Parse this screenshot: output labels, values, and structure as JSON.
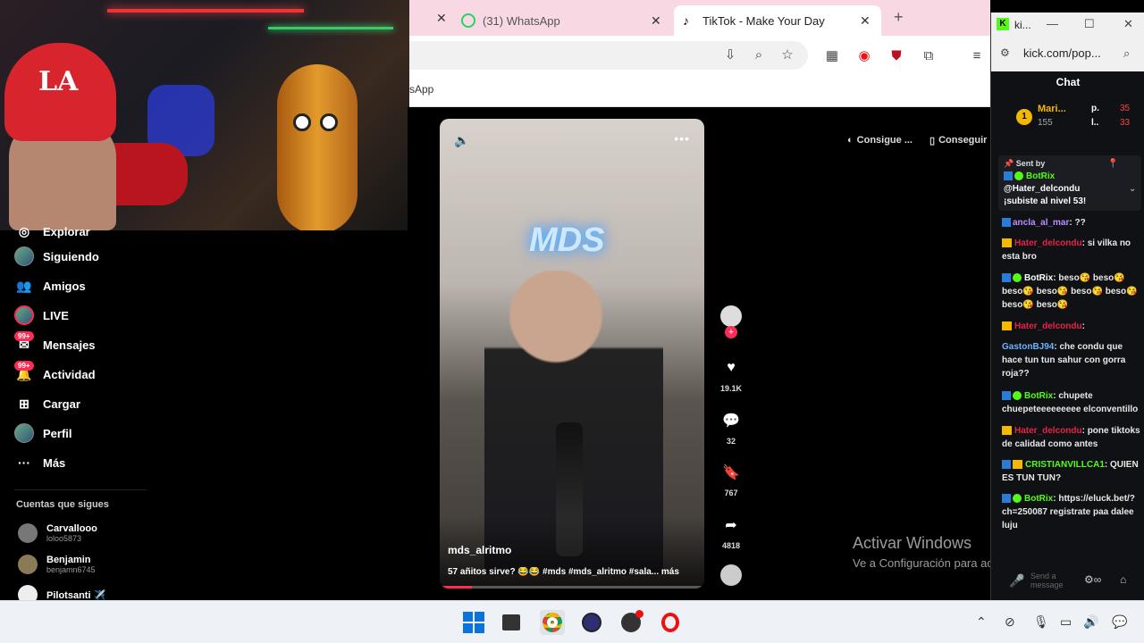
{
  "browser": {
    "tabs": [
      {
        "title": "(31) WhatsApp",
        "close": "✕"
      },
      {
        "title": "TikTok - Make Your Day",
        "close": "✕"
      }
    ],
    "first_tab_close": "✕",
    "new_tab": "+",
    "bookmark_partial": "sApp"
  },
  "sidebar": {
    "items": [
      {
        "label": "Siguiendo",
        "badge": ""
      },
      {
        "label": "Amigos",
        "badge": ""
      },
      {
        "label": "LIVE",
        "badge": ""
      },
      {
        "label": "Mensajes",
        "badge": "99+"
      },
      {
        "label": "Actividad",
        "badge": "99+"
      },
      {
        "label": "Cargar",
        "badge": ""
      },
      {
        "label": "Perfil",
        "badge": ""
      },
      {
        "label": "Más",
        "badge": ""
      }
    ],
    "partial_item": "Explorar",
    "follows_title": "Cuentas que sigues",
    "follows": [
      {
        "name": "Carvallooo",
        "handle": "loloo5873"
      },
      {
        "name": "Benjamin",
        "handle": "benjamn6745"
      },
      {
        "name": "Pilotsanti ✈️",
        "handle": ""
      }
    ]
  },
  "video": {
    "neon_sign": "MDS",
    "username": "mds_alritmo",
    "caption": "57 añitos sirve? 😂😂 #mds #mds_alritmo #sala...",
    "more": "más",
    "progress": 0.12,
    "actions": {
      "likes": "19.1K",
      "comments": "32",
      "saves": "767",
      "shares": "4818"
    }
  },
  "get_app": {
    "coins": "Consigue ...",
    "app": "Conseguir"
  },
  "activate_windows": {
    "title": "Activar Windows",
    "subtitle": "Ve a Configuración para activar Windows."
  },
  "kick": {
    "tab_title": "ki...",
    "url": "kick.com/pop...",
    "chat_title": "Chat",
    "leaderboard": {
      "rank": "1",
      "name": "Mari...",
      "points": "155",
      "p1_label": "p.",
      "p1_value": "35",
      "p2_label": "l..",
      "p2_value": "33"
    },
    "pinned": {
      "label": "Sent by",
      "user": "BotRix",
      "text_line1": "@Hater_delcondu",
      "text_line2": "¡subiste al nivel 53!"
    },
    "messages": [
      {
        "user": "ancla_al_mar",
        "color": "#b890ff",
        "badges": "bot",
        "text": "??"
      },
      {
        "user": "Hater_delcondu",
        "color": "#e8234a",
        "badges": "crown",
        "text": "si vilka no esta bro"
      },
      {
        "user": "BotRix",
        "color": "#ffffff",
        "badges": "bot-check",
        "text": "beso😘 beso😘 beso😘 beso😘 beso😘 beso😘 beso😘 beso😘"
      },
      {
        "user": "Hater_delcondu",
        "color": "#e8234a",
        "badges": "crown",
        "text": ""
      },
      {
        "user": "GastonBJ94",
        "color": "#6ab4ff",
        "badges": "",
        "text": "che condu que hace tun tun sahur con gorra roja??"
      },
      {
        "user": "BotRix",
        "color": "#53fc18",
        "badges": "bot-check",
        "text": "chupete chuepeteeeeeeeee elconventillo"
      },
      {
        "user": "Hater_delcondu",
        "color": "#e8234a",
        "badges": "crown",
        "text": "pone tiktoks de calidad como antes"
      },
      {
        "user": "CRISTIANVILLCA1",
        "color": "#53fc18",
        "badges": "bot-crown",
        "text": "QUIEN ES TUN TUN?"
      },
      {
        "user": "BotRix",
        "color": "#53fc18",
        "badges": "bot-check",
        "text": "https://eluck.bet/?ch=250087 registrate paa dalee luju"
      }
    ],
    "input_placeholder": "Send a message"
  },
  "colors": {
    "tab_bar": "#f8d9e3",
    "tiktok_pink": "#fe2c55",
    "kick_green": "#53fc18"
  }
}
